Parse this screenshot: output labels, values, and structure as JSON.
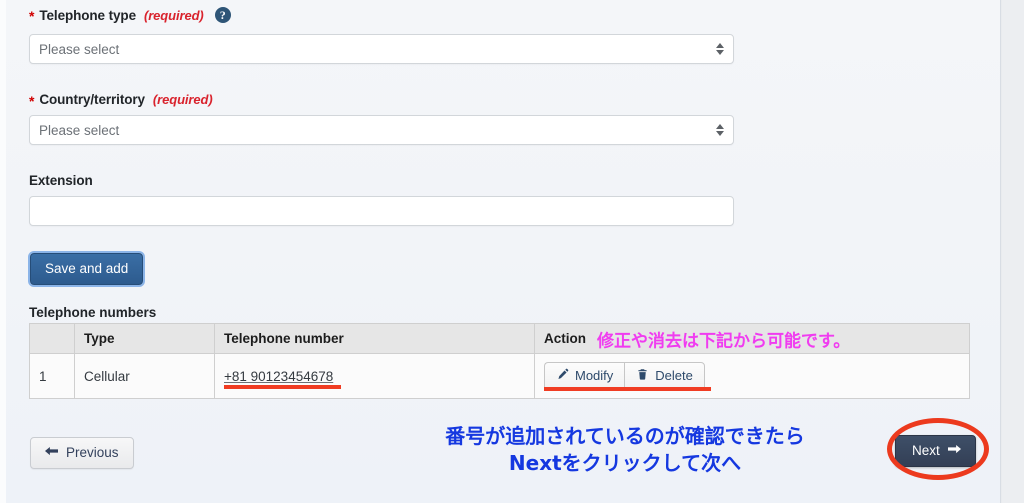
{
  "form": {
    "telephone_type": {
      "label": "Telephone type",
      "required_marker": "*",
      "required_text": "(required)",
      "help_icon": "question-mark-circle-icon",
      "help_glyph": "?",
      "value": "Please select"
    },
    "country_territory": {
      "label": "Country/territory",
      "required_marker": "*",
      "required_text": "(required)",
      "value": "Please select"
    },
    "extension": {
      "label": "Extension",
      "value": "",
      "placeholder": ""
    },
    "save_and_add_label": "Save and add"
  },
  "table": {
    "title": "Telephone numbers",
    "headers": [
      "",
      "Type",
      "Telephone number",
      "Action"
    ],
    "rows": [
      {
        "index": "1",
        "type": "Cellular",
        "number": "+81 90123454678",
        "modify_label": "Modify",
        "delete_label": "Delete"
      }
    ]
  },
  "footer": {
    "previous_label": "Previous",
    "next_label": "Next"
  },
  "annotations": {
    "magenta_note": "修正や消去は下記から可能です。",
    "blue_note_line1": "番号が追加されているのが確認できたら",
    "blue_note_line2": "Nextをクリックして次へ"
  },
  "colors": {
    "required_red": "#d9232d",
    "annotation_red": "#f03c22",
    "annotation_magenta": "#f03cf0",
    "annotation_blue": "#1538e0",
    "save_button_blue": "#2d5b8e",
    "next_button_navy": "#333f55",
    "table_header_gray": "#e6e6e6"
  }
}
